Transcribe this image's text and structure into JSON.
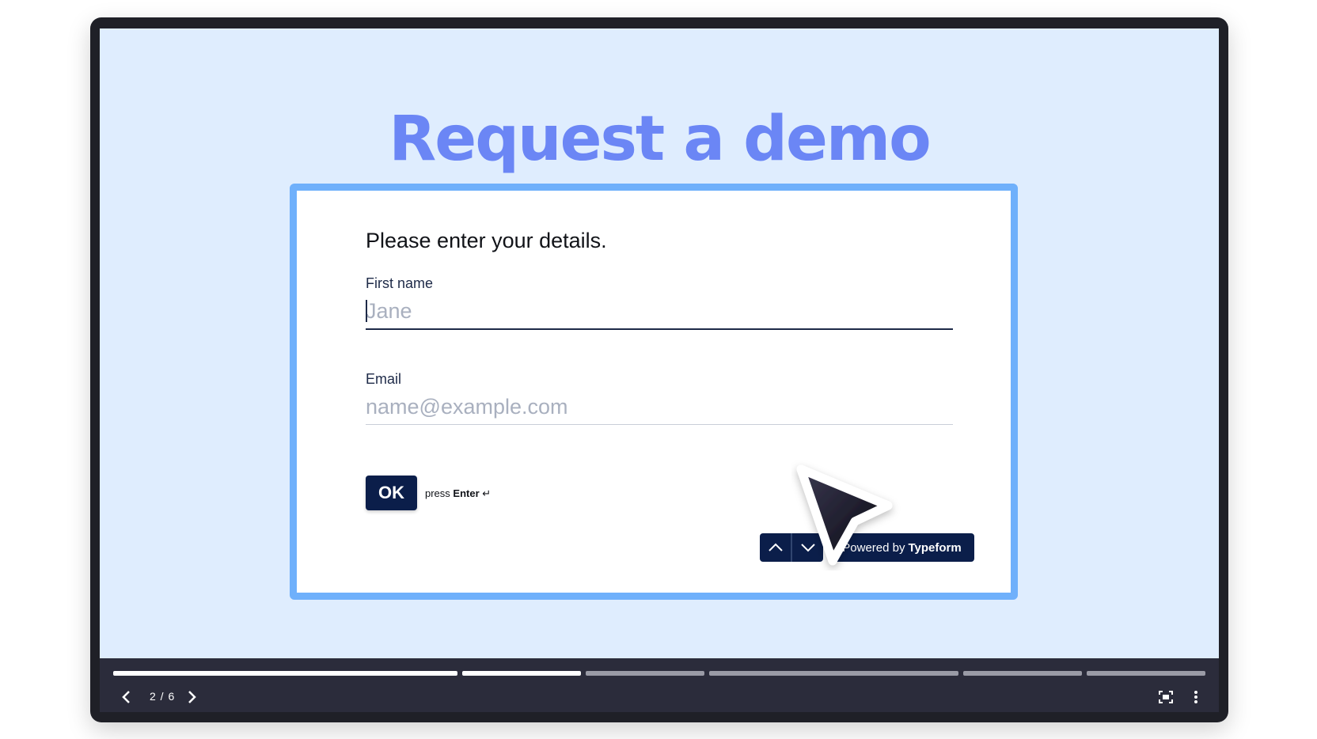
{
  "headline": "Request a demo",
  "form": {
    "question": "Please enter your details.",
    "first_name": {
      "label": "First name",
      "placeholder": "Jane",
      "value": ""
    },
    "email": {
      "label": "Email",
      "placeholder": "name@example.com",
      "value": ""
    },
    "ok_label": "OK",
    "press_prefix": "press",
    "press_key": "Enter",
    "press_symbol": "↵",
    "powered_prefix": "Powered by",
    "powered_brand": "Typeform",
    "nav_icons": [
      "chevron-up-icon",
      "chevron-down-icon"
    ]
  },
  "player": {
    "page_counter": "2 / 6",
    "current_slide": 2,
    "total_slides": 6,
    "icons": [
      "chevron-left-icon",
      "chevron-right-icon",
      "fullscreen-icon",
      "more-vertical-icon"
    ],
    "progress_segments": [
      {
        "state": "complete",
        "weight": 2.9
      },
      {
        "state": "current",
        "weight": 1.0
      },
      {
        "state": "upcoming",
        "weight": 1.0
      },
      {
        "state": "upcoming",
        "weight": 2.1
      },
      {
        "state": "upcoming",
        "weight": 1.0
      },
      {
        "state": "upcoming",
        "weight": 1.0
      }
    ]
  },
  "colors": {
    "headline": "#6b86f5",
    "screen_background": "#dfedfe",
    "card_border": "#6fb0fb",
    "button": "#0b1e4a",
    "progress_active": "#ffffff",
    "progress_inactive": "#9a9ba6"
  }
}
